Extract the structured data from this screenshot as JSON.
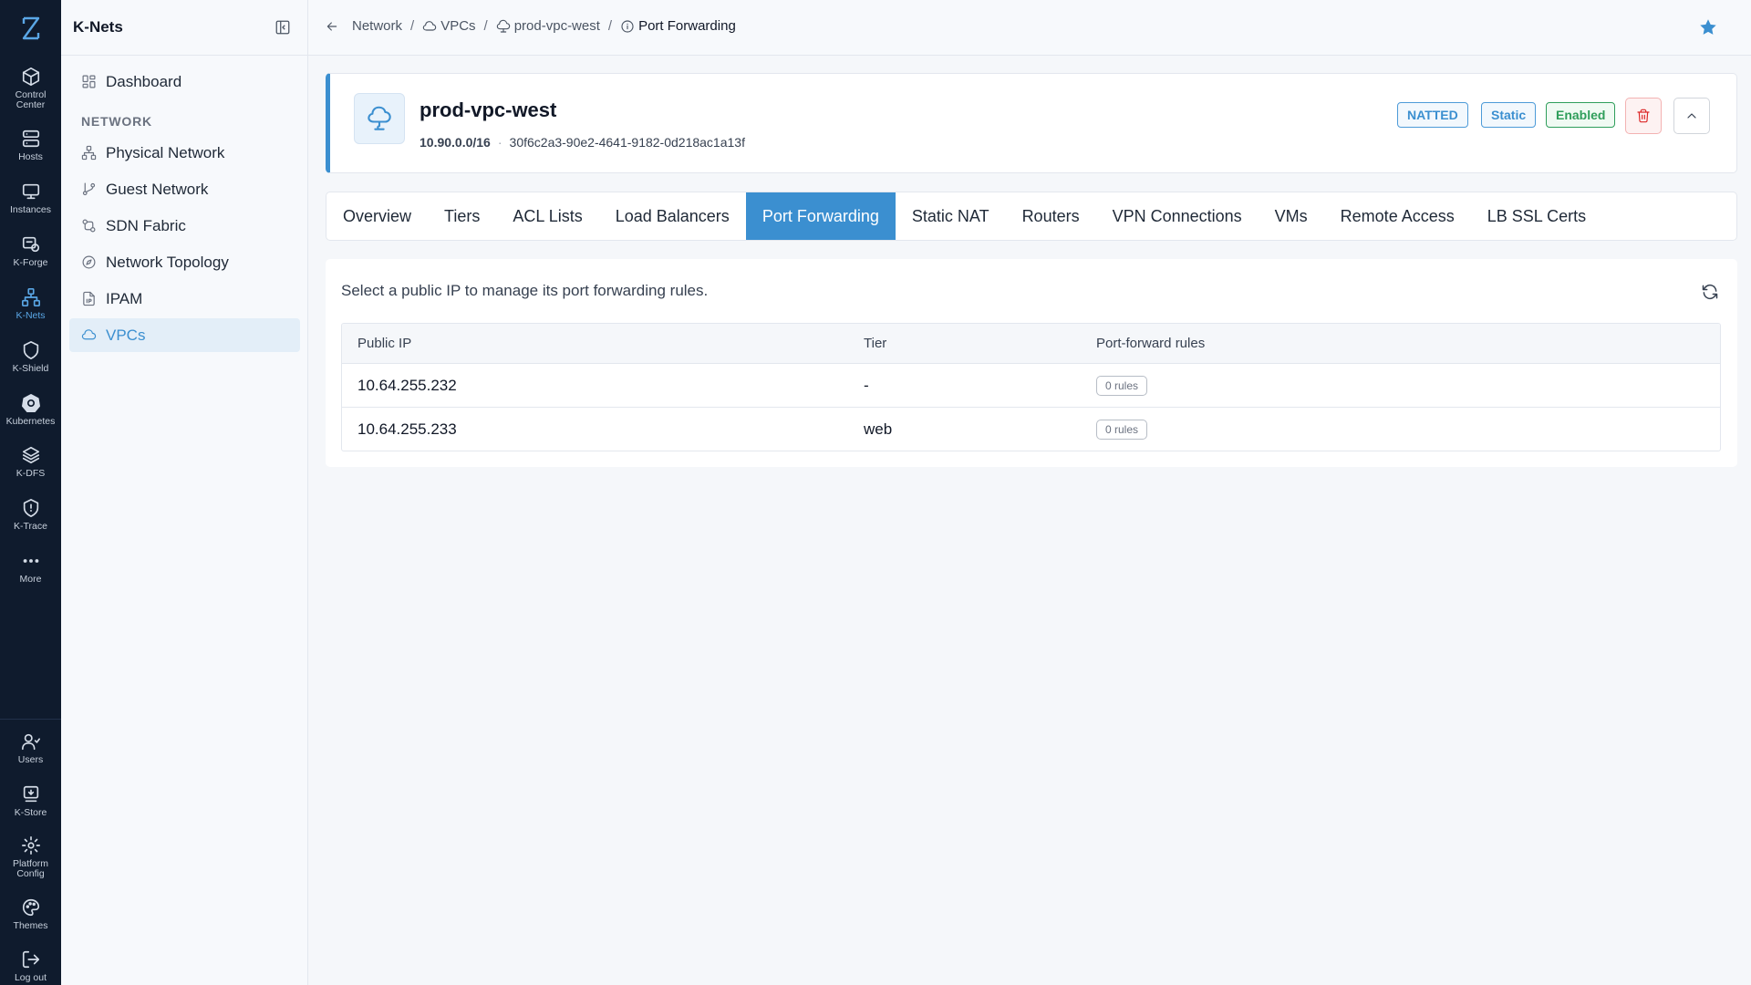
{
  "rail": {
    "items": [
      {
        "label": "Control Center",
        "icon": "cube-icon"
      },
      {
        "label": "Hosts",
        "icon": "server-icon"
      },
      {
        "label": "Instances",
        "icon": "monitor-icon"
      },
      {
        "label": "K-Forge",
        "icon": "forge-icon"
      },
      {
        "label": "K-Nets",
        "icon": "network-icon",
        "active": true
      },
      {
        "label": "K-Shield",
        "icon": "shield-icon"
      },
      {
        "label": "Kubernetes",
        "icon": "kubernetes-icon"
      },
      {
        "label": "K-DFS",
        "icon": "layers-icon"
      },
      {
        "label": "K-Trace",
        "icon": "trace-shield-icon"
      },
      {
        "label": "More",
        "icon": "more-icon"
      },
      {
        "label": "Users",
        "icon": "users-icon"
      },
      {
        "label": "K-Store",
        "icon": "store-icon"
      },
      {
        "label": "Platform Config",
        "icon": "gear-icon"
      },
      {
        "label": "Themes",
        "icon": "palette-icon"
      },
      {
        "label": "Log out",
        "icon": "logout-icon"
      }
    ]
  },
  "sidebar": {
    "title": "K-Nets",
    "dashboard": "Dashboard",
    "section": "NETWORK",
    "items": [
      {
        "label": "Physical Network"
      },
      {
        "label": "Guest Network"
      },
      {
        "label": "SDN Fabric"
      },
      {
        "label": "Network Topology"
      },
      {
        "label": "IPAM"
      },
      {
        "label": "VPCs",
        "active": true
      }
    ]
  },
  "breadcrumb": {
    "items": [
      "Network",
      "VPCs",
      "prod-vpc-west",
      "Port Forwarding"
    ],
    "separator": "/"
  },
  "vpc": {
    "name": "prod-vpc-west",
    "cidr": "10.90.0.0/16",
    "dot": "·",
    "id": "30f6c2a3-90e2-4641-9182-0d218ac1a13f",
    "badges": {
      "natted": "NATTED",
      "static": "Static",
      "enabled": "Enabled"
    }
  },
  "tabs": [
    "Overview",
    "Tiers",
    "ACL Lists",
    "Load Balancers",
    "Port Forwarding",
    "Static NAT",
    "Routers",
    "VPN Connections",
    "VMs",
    "Remote Access",
    "LB SSL Certs"
  ],
  "active_tab": "Port Forwarding",
  "panel": {
    "message": "Select a public IP to manage its port forwarding rules.",
    "columns": [
      "Public IP",
      "Tier",
      "Port-forward rules"
    ],
    "rows": [
      {
        "ip": "10.64.255.232",
        "tier": "-",
        "rules": "0 rules"
      },
      {
        "ip": "10.64.255.233",
        "tier": "web",
        "rules": "0 rules"
      }
    ]
  },
  "colors": {
    "accent": "#3b8fd0",
    "rail_bg": "#0f1b2d",
    "success": "#2f9e5b",
    "danger": "#dc2626"
  }
}
